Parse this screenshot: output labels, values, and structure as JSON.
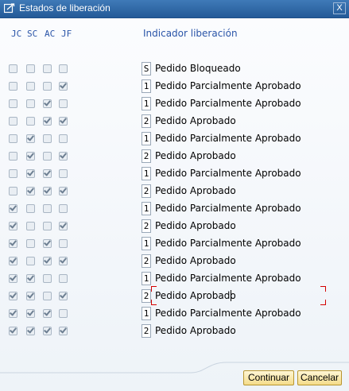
{
  "window": {
    "title": "Estados de liberación",
    "close_label": "X"
  },
  "headers": {
    "jc": "JC",
    "sc": "SC",
    "ac": "AC",
    "jf": "JF",
    "indicator": "Indicador liberación"
  },
  "rows": [
    {
      "jc": false,
      "sc": false,
      "ac": false,
      "jf": false,
      "indicator": "S",
      "text": "Pedido Bloqueado"
    },
    {
      "jc": false,
      "sc": false,
      "ac": false,
      "jf": true,
      "indicator": "1",
      "text": "Pedido Parcialmente Aprobado"
    },
    {
      "jc": false,
      "sc": false,
      "ac": true,
      "jf": false,
      "indicator": "1",
      "text": "Pedido Parcialmente Aprobado"
    },
    {
      "jc": false,
      "sc": false,
      "ac": true,
      "jf": true,
      "indicator": "2",
      "text": "Pedido Aprobado"
    },
    {
      "jc": false,
      "sc": true,
      "ac": false,
      "jf": false,
      "indicator": "1",
      "text": "Pedido Parcialmente Aprobado"
    },
    {
      "jc": false,
      "sc": true,
      "ac": false,
      "jf": true,
      "indicator": "2",
      "text": "Pedido Aprobado"
    },
    {
      "jc": false,
      "sc": true,
      "ac": true,
      "jf": false,
      "indicator": "1",
      "text": "Pedido Parcialmente Aprobado"
    },
    {
      "jc": false,
      "sc": true,
      "ac": true,
      "jf": true,
      "indicator": "2",
      "text": "Pedido Aprobado"
    },
    {
      "jc": true,
      "sc": false,
      "ac": false,
      "jf": false,
      "indicator": "1",
      "text": "Pedido Parcialmente Aprobado"
    },
    {
      "jc": true,
      "sc": false,
      "ac": false,
      "jf": true,
      "indicator": "2",
      "text": "Pedido Aprobado"
    },
    {
      "jc": true,
      "sc": false,
      "ac": true,
      "jf": false,
      "indicator": "1",
      "text": "Pedido Parcialmente Aprobado"
    },
    {
      "jc": true,
      "sc": false,
      "ac": true,
      "jf": true,
      "indicator": "2",
      "text": "Pedido Aprobado"
    },
    {
      "jc": true,
      "sc": true,
      "ac": false,
      "jf": false,
      "indicator": "1",
      "text": "Pedido Parcialmente Aprobado"
    },
    {
      "jc": true,
      "sc": true,
      "ac": false,
      "jf": true,
      "indicator": "2",
      "text": "Pedido Aprobado",
      "focused": true
    },
    {
      "jc": true,
      "sc": true,
      "ac": true,
      "jf": false,
      "indicator": "1",
      "text": "Pedido Parcialmente Aprobado"
    },
    {
      "jc": true,
      "sc": true,
      "ac": true,
      "jf": true,
      "indicator": "2",
      "text": "Pedido Aprobado"
    }
  ],
  "buttons": {
    "continue": "Continuar",
    "cancel": "Cancelar"
  },
  "colors": {
    "titlebar": "#2f6aa8",
    "header_text": "#2a55a8",
    "button_bg": "#f7e6a3",
    "focus_marker": "#d40000"
  }
}
